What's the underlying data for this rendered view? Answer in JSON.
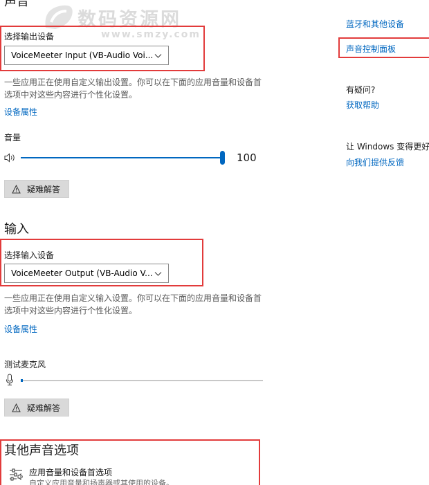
{
  "output": {
    "title": "声音",
    "device_label": "选择输出设备",
    "device_value": "VoiceMeeter Input (VB-Audio Voi...",
    "description": "一些应用正在使用自定义输出设置。你可以在下面的应用音量和设备首选项中对这些内容进行个性化设置。",
    "properties_link": "设备属性",
    "volume_label": "音量",
    "volume_value": "100",
    "volume_level": 1.0,
    "troubleshoot_label": "疑难解答"
  },
  "input": {
    "title": "输入",
    "device_label": "选择输入设备",
    "device_value": "VoiceMeeter Output (VB-Audio V...",
    "description": "一些应用正在使用自定义输入设置。你可以在下面的应用音量和设备首选项中对这些内容进行个性化设置。",
    "properties_link": "设备属性",
    "mic_test_label": "测试麦克风",
    "mic_level": 0.0,
    "troubleshoot_label": "疑难解答"
  },
  "other": {
    "title": "其他声音选项",
    "app_volume_title": "应用音量和设备首选项",
    "app_volume_desc": "自定义应用音量和扬声器或其使用的设备。"
  },
  "sidebar": {
    "bluetooth_link": "蓝牙和其他设备",
    "sound_panel_link": "声音控制面板",
    "question_title": "有疑问?",
    "help_link": "获取帮助",
    "improve_title": "让 Windows 变得更好",
    "feedback_link": "向我们提供反馈"
  },
  "watermark": {
    "title": "数码资源网",
    "url": "www.smzy.com"
  },
  "colors": {
    "accent": "#0067c0",
    "highlight_box": "#e23b3b"
  }
}
